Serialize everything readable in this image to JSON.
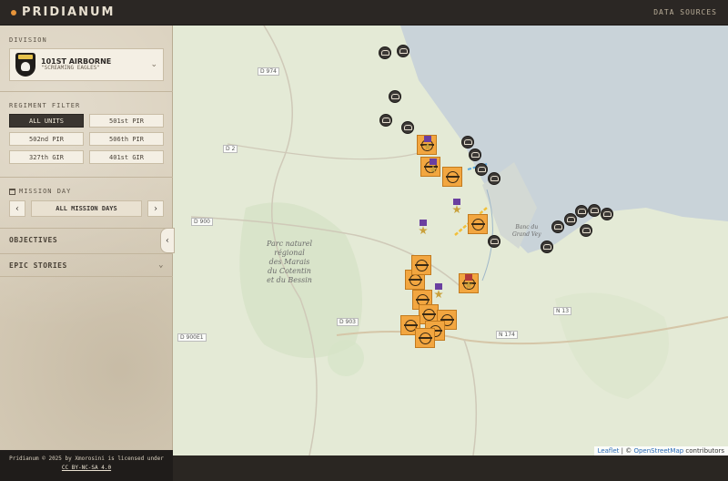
{
  "app": {
    "title": "PRIDIANUM",
    "data_sources": "DATA SOURCES"
  },
  "sidebar": {
    "division_label": "DIVISION",
    "division": {
      "name": "101ST AIRBORNE",
      "nickname": "\"SCREAMING EAGLES\""
    },
    "regiment_label": "REGIMENT FILTER",
    "regiments": [
      {
        "label": "ALL UNITS",
        "active": true
      },
      {
        "label": "501st PIR",
        "active": false
      },
      {
        "label": "502nd PIR",
        "active": false
      },
      {
        "label": "506th PIR",
        "active": false
      },
      {
        "label": "327th GIR",
        "active": false
      },
      {
        "label": "401st GIR",
        "active": false
      }
    ],
    "mission_label": "MISSION DAY",
    "mission_all": "ALL MISSION DAYS",
    "objectives_label": "OBJECTIVES",
    "epic_label": "EPIC STORIES"
  },
  "license": {
    "line1": "Pridianum © 2025 by Xmorosini is licensed under",
    "line2": "CC BY-NC-SA 4.0"
  },
  "map": {
    "road_labels": [
      "D 974",
      "D 2",
      "D 900",
      "D 903",
      "D 900E1",
      "N 174",
      "N 13"
    ],
    "place_label": "Parc naturel\nrégional\ndes Marais\ndu Cotentin\net du Bessin",
    "bay_label": "Banc du\nGrand Vey",
    "attribution": {
      "leaflet": "Leaflet",
      "sep": " | © ",
      "osm": "OpenStreetMap",
      "tail": " contributors"
    }
  }
}
